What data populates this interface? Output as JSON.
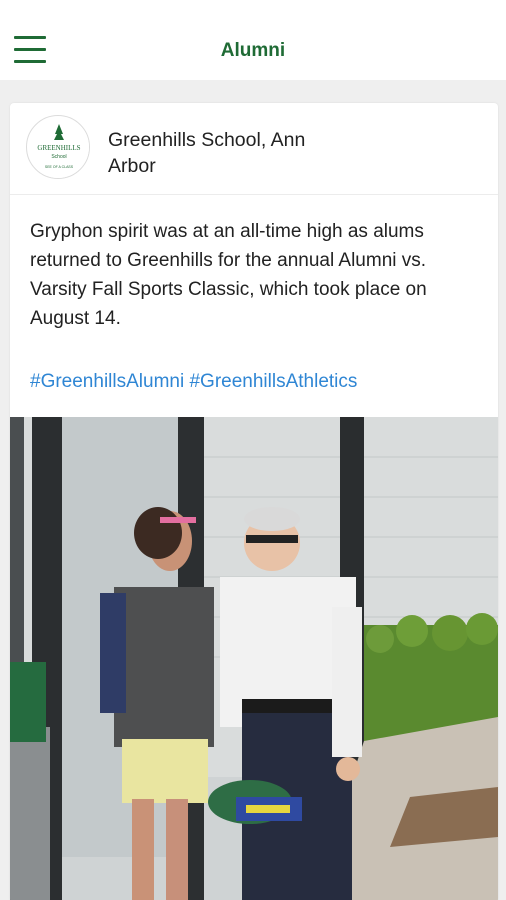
{
  "header": {
    "title": "Alumni"
  },
  "post": {
    "author": "Greenhills School, Ann Arbor",
    "text": "Gryphon spirit was at an all-time high as alums returned to Greenhills for the annual Alumni vs. Varsity Fall Sports Classic, which took place on August 14.",
    "hashtags": [
      "#GreenhillsAlumni",
      "#GreenhillsAthletics"
    ],
    "logo": {
      "name": "GREENHILLS",
      "sub": "School",
      "motto": "SEE OF A CLASS"
    }
  },
  "colors": {
    "brand_green": "#1f6b35",
    "hashtag_blue": "#2f86d4"
  }
}
